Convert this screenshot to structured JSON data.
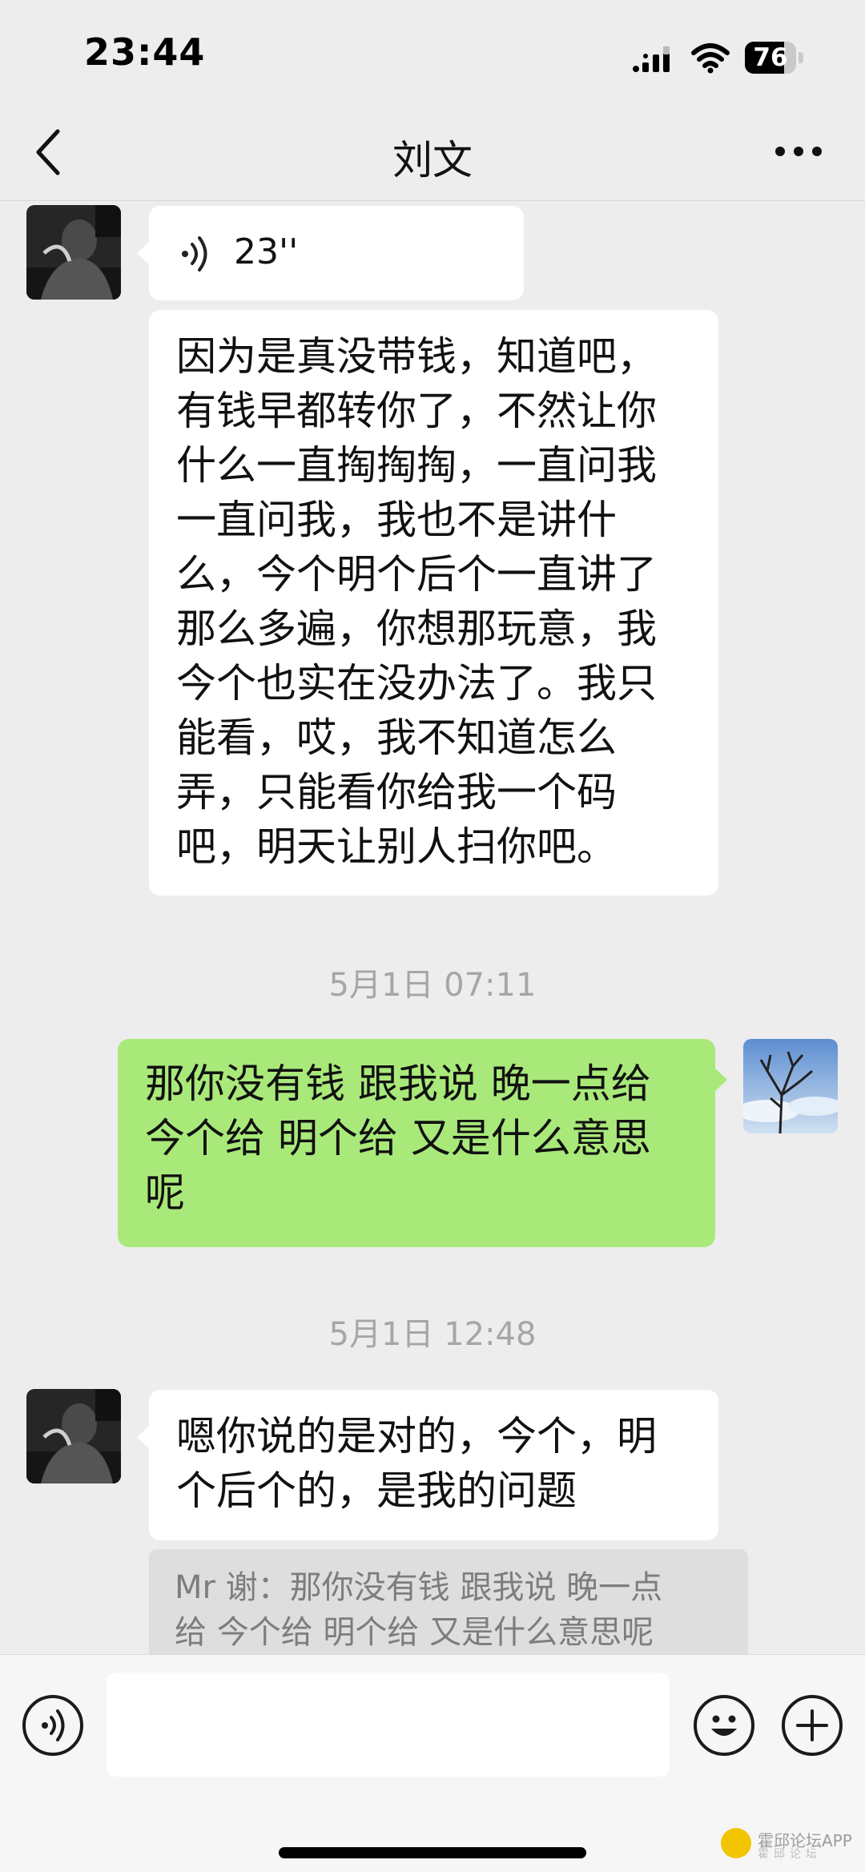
{
  "status_bar": {
    "time": "23:44",
    "battery_text": "76",
    "battery_level": 0.76
  },
  "nav": {
    "title": "刘文",
    "back_icon": "chevron-left-icon",
    "more_icon": "more-icon"
  },
  "messages": [
    {
      "id": "m1",
      "direction": "incoming",
      "type": "voice",
      "duration": "23''"
    },
    {
      "id": "m2",
      "direction": "incoming",
      "type": "text",
      "lines": [
        "因为是真没带钱，知道吧，",
        "有钱早都转你了，不然让你",
        "什么一直掏掏掏，一直问我",
        "一直问我，我也不是讲什",
        "么，今个明个后个一直讲了",
        "那么多遍，你想那玩意，我",
        "今个也实在没办法了。我只",
        "能看，哎，我不知道怎么",
        "弄，只能看你给我一个码",
        "吧，明天让别人扫你吧。"
      ]
    },
    {
      "id": "t1",
      "type": "timestamp",
      "text": "5月1日 07:11"
    },
    {
      "id": "m3",
      "direction": "outgoing",
      "type": "text",
      "lines": [
        "那你没有钱 跟我说 晚一点给",
        "今个给 明个给 又是什么意思",
        "呢"
      ]
    },
    {
      "id": "t2",
      "type": "timestamp",
      "text": "5月1日 12:48"
    },
    {
      "id": "m4",
      "direction": "incoming",
      "type": "text",
      "lines": [
        "嗯你说的是对的，今个，明",
        "个后个的，是我的问题"
      ],
      "quote_lines": [
        "Mr 谢：那你没有钱 跟我说 晚一点",
        "给 今个给 明个给 又是什么意思呢"
      ]
    }
  ],
  "input_bar": {
    "voice_icon": "voice-icon",
    "emoji_icon": "emoji-icon",
    "plus_icon": "plus-icon",
    "input_value": ""
  },
  "watermark": {
    "text": "霍邱论坛APP",
    "sub": "霍邱论坛"
  },
  "colors": {
    "background": "#ededed",
    "incoming_bubble": "#ffffff",
    "outgoing_bubble": "#a9e97a",
    "timestamp": "#a6a6a6"
  }
}
